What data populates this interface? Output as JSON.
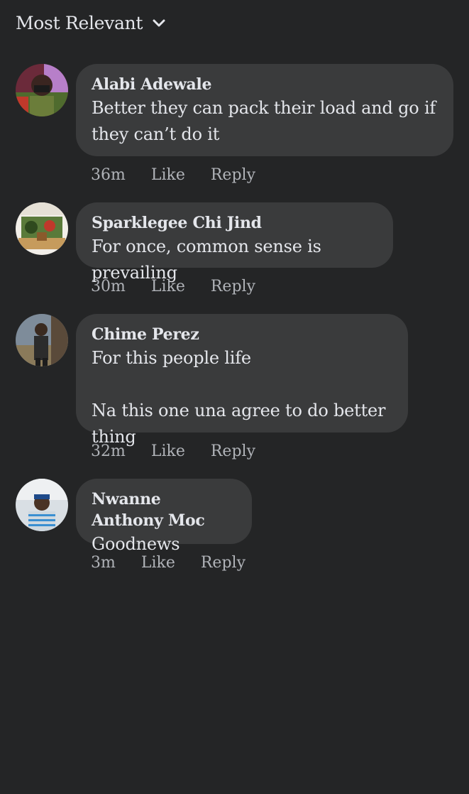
{
  "sort": {
    "label": "Most Relevant"
  },
  "comments": [
    {
      "author": "Alabi Adewale",
      "text": "Better they can pack their load and go if they can’t do it",
      "time": "36m",
      "like": "Like",
      "reply": "Reply"
    },
    {
      "author": "Sparklegee Chi Jind",
      "text": "For once, common sense is prevailing",
      "time": "30m",
      "like": "Like",
      "reply": "Reply"
    },
    {
      "author": "Chime Perez",
      "text": "For this people life\n\nNa this one una agree to do better thing",
      "time": "32m",
      "like": "Like",
      "reply": "Reply"
    },
    {
      "author": "Nwanne Anthony Moc",
      "text": "Goodnews",
      "time": "3m",
      "like": "Like",
      "reply": "Reply"
    }
  ],
  "colors": {
    "background": "#242526",
    "bubble": "#3a3b3c",
    "primary_text": "#e4e6eb",
    "secondary_text": "#b0b3b8"
  }
}
